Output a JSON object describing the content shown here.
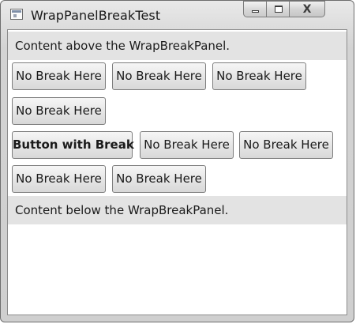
{
  "window": {
    "title": "WrapPanelBreakTest",
    "icons": {
      "app": "window-app-icon",
      "minimize": "minimize-icon",
      "maximize": "maximize-icon",
      "close": "close-icon"
    },
    "close_glyph": "X"
  },
  "content": {
    "above_text": "Content above the WrapBreakPanel.",
    "below_text": "Content below the WrapBreakPanel."
  },
  "buttons": [
    {
      "label": "No Break Here",
      "bold": false
    },
    {
      "label": "No Break Here",
      "bold": false
    },
    {
      "label": "No Break Here",
      "bold": false
    },
    {
      "label": "No Break Here",
      "bold": false
    },
    {
      "label": "Button with Break",
      "bold": true
    },
    {
      "label": "No Break Here",
      "bold": false
    },
    {
      "label": "No Break Here",
      "bold": false
    },
    {
      "label": "No Break Here",
      "bold": false
    },
    {
      "label": "No Break Here",
      "bold": false
    }
  ]
}
